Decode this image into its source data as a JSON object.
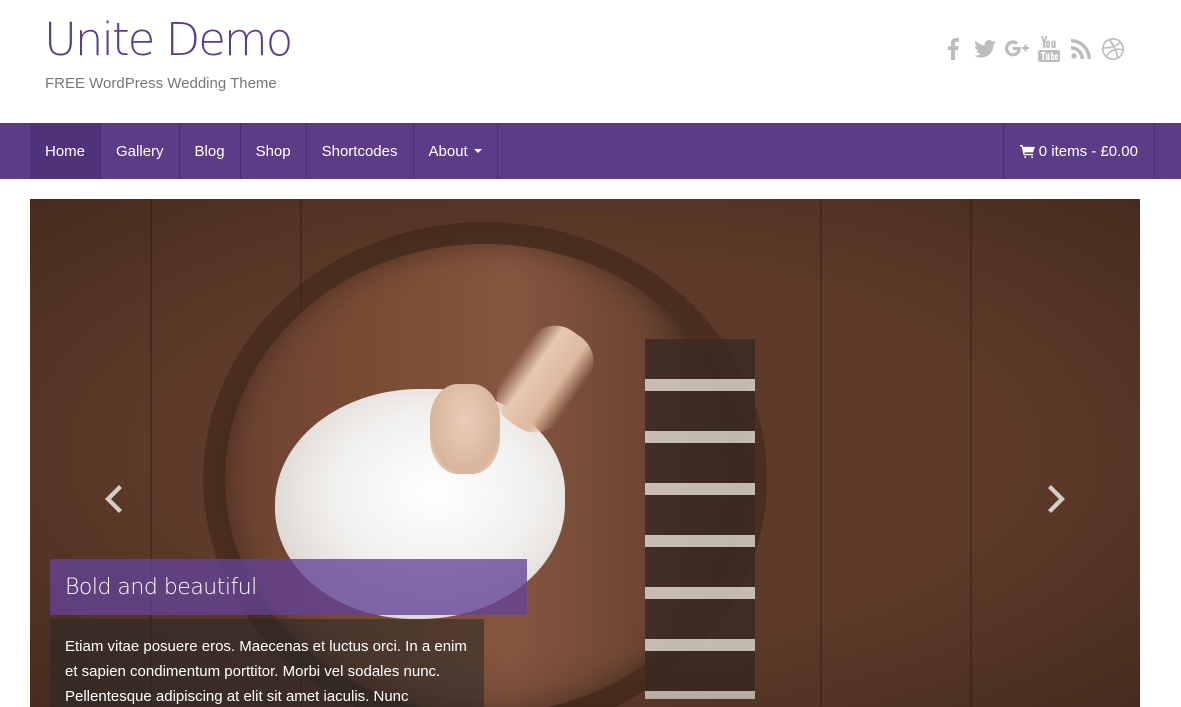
{
  "header": {
    "site_title": "Unite Demo",
    "site_description": "FREE WordPress Wedding Theme",
    "social_icons": [
      "facebook-icon",
      "twitter-icon",
      "google-plus-icon",
      "youtube-icon",
      "rss-icon",
      "dribbble-icon"
    ]
  },
  "nav": {
    "items": [
      {
        "label": "Home",
        "active": true
      },
      {
        "label": "Gallery"
      },
      {
        "label": "Blog"
      },
      {
        "label": "Shop"
      },
      {
        "label": "Shortcodes"
      },
      {
        "label": "About",
        "has_dropdown": true
      }
    ],
    "cart_label": "0 items - £0.00",
    "background_color": "#5c3b87"
  },
  "slider": {
    "caption_title": "Bold and beautiful",
    "caption_text": "Etiam vitae posuere eros. Maecenas et luctus orci. In a enim et sapien condimentum porttitor. Morbi vel sodales nunc. Pellentesque adipiscing at elit sit amet iaculis. Nunc",
    "prev_icon": "chevron-left-icon",
    "next_icon": "chevron-right-icon"
  },
  "colors": {
    "brand_purple": "#5a3d8a",
    "caption_purple": "#6343a0"
  }
}
